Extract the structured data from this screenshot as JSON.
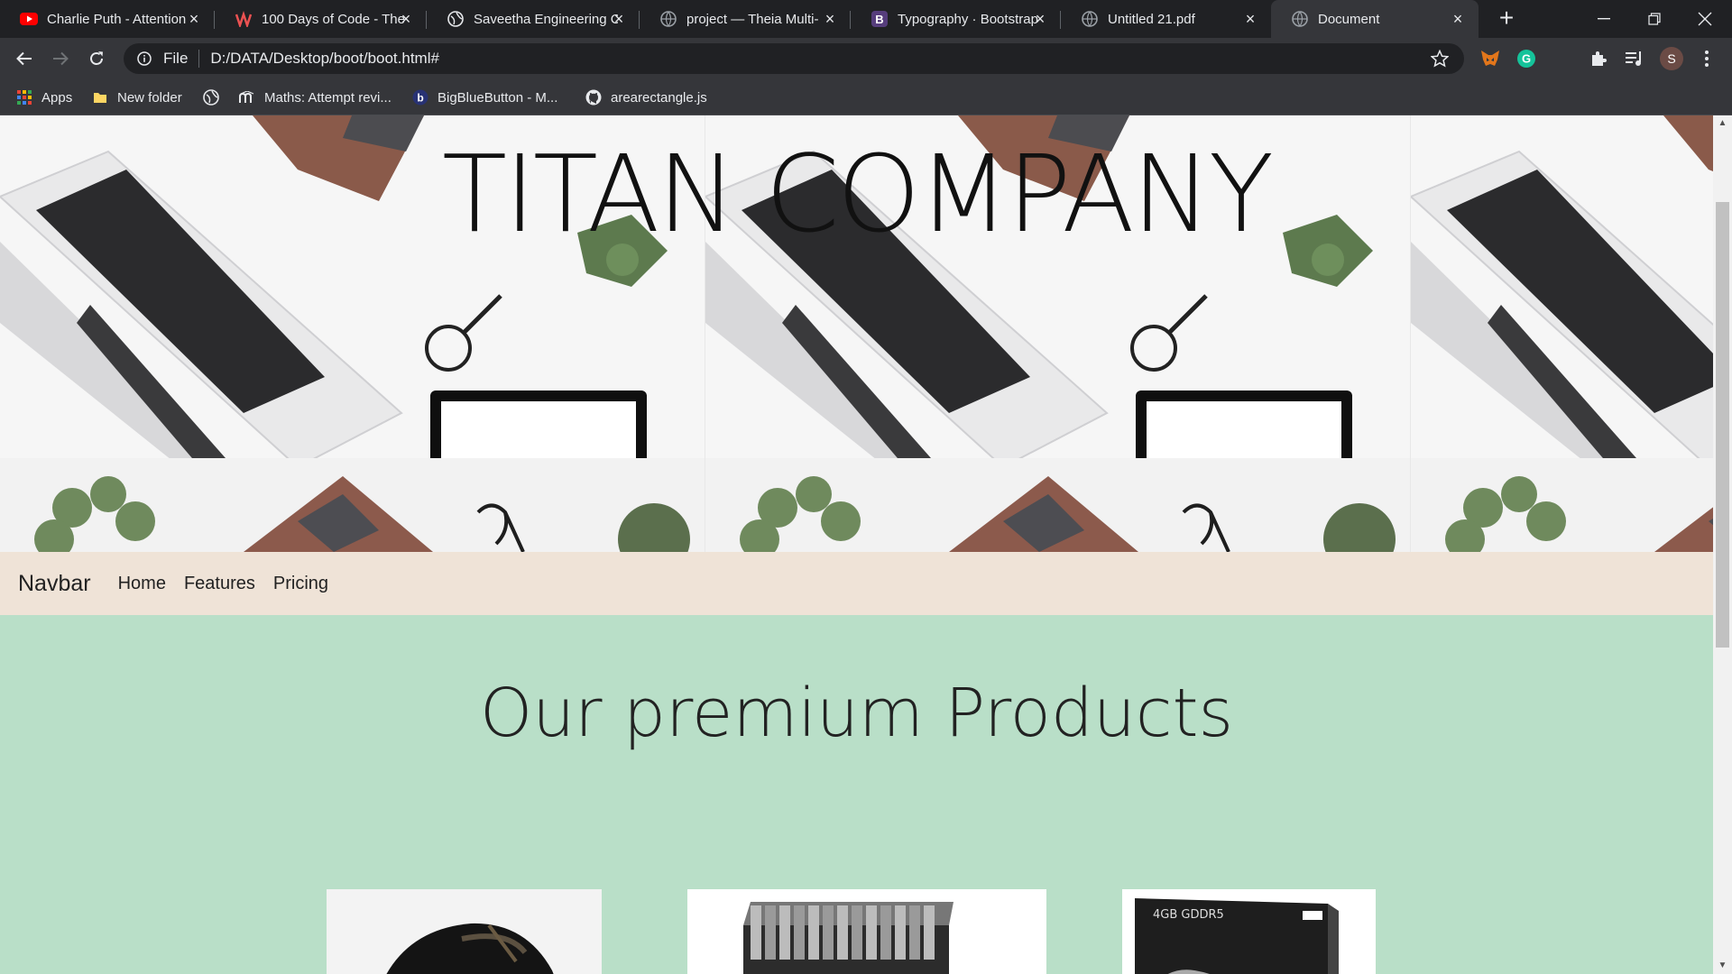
{
  "browser": {
    "tabs": [
      {
        "title": "Charlie Puth - Attention",
        "icon": "youtube-icon",
        "active": false
      },
      {
        "title": "100 Days of Code - The",
        "icon": "udemy-icon",
        "active": false
      },
      {
        "title": "Saveetha Engineering C",
        "icon": "globe-icon",
        "active": false
      },
      {
        "title": "project — Theia Multi-",
        "icon": "globe-icon",
        "active": false
      },
      {
        "title": "Typography · Bootstrap",
        "icon": "bootstrap-icon",
        "active": false
      },
      {
        "title": "Untitled 21.pdf",
        "icon": "globe-icon",
        "active": false
      },
      {
        "title": "Document",
        "icon": "globe-icon",
        "active": true
      }
    ],
    "address": {
      "scheme_label": "File",
      "url": "D:/DATA/Desktop/boot/boot.html#"
    },
    "profile_initial": "S",
    "bookmarks": [
      {
        "label": "Apps",
        "icon": "apps-grid-icon"
      },
      {
        "label": "New folder",
        "icon": "folder-icon"
      },
      {
        "label": "",
        "icon": "globe-icon"
      },
      {
        "label": "Maths: Attempt revi...",
        "icon": "moodle-icon"
      },
      {
        "label": "BigBlueButton - M...",
        "icon": "bigbluebutton-icon"
      },
      {
        "label": "arearectangle.js",
        "icon": "github-icon"
      }
    ]
  },
  "page": {
    "hero_title": "TITAN COMPANY",
    "navbar": {
      "brand": "Navbar",
      "links": [
        "Home",
        "Features",
        "Pricing"
      ]
    },
    "products_heading": "Our premium Products",
    "product_cards": [
      {
        "image": "black-hardware-product"
      },
      {
        "image": "server-rack-product"
      },
      {
        "image": "graphics-card-box-product",
        "box_text": "4GB GDDR5"
      }
    ]
  },
  "colors": {
    "products_bg": "#b9dfc8",
    "navbar_bg": "#efe3d7",
    "chrome_dark": "#202124",
    "chrome_toolbar": "#35363a"
  }
}
